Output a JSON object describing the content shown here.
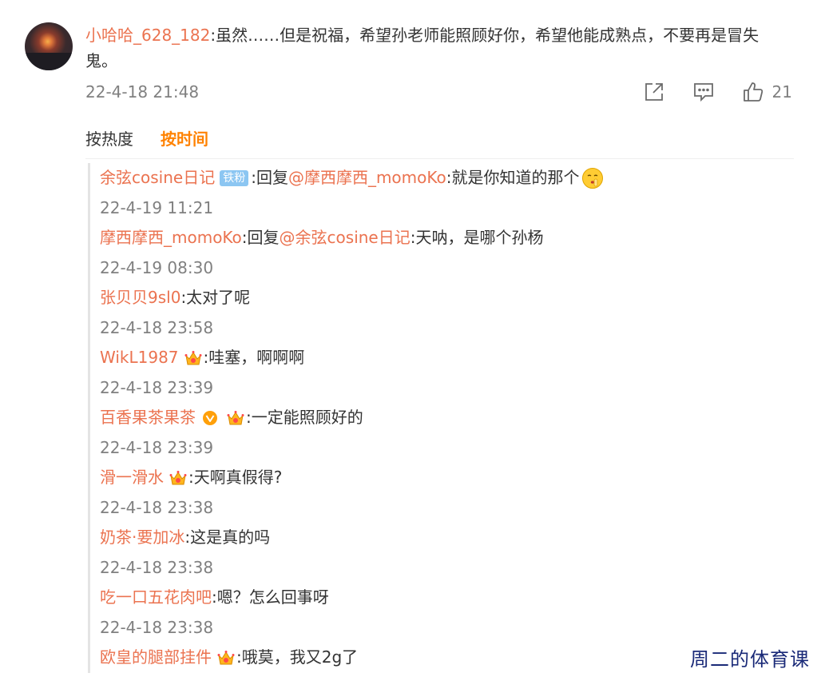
{
  "main_comment": {
    "username": "小哈哈_628_182",
    "text": ":虽然……但是祝福，希望孙老师能照顾好你，希望他能成熟点，不要再是冒失鬼。",
    "timestamp": "22-4-18 21:48",
    "like_count": "21",
    "icons": [
      "share-icon",
      "comment-icon",
      "like-icon"
    ]
  },
  "sort": {
    "hot": "按热度",
    "time": "按时间",
    "active": "time"
  },
  "replies": [
    {
      "user": "余弦cosine日记",
      "fan_badge": "铁粉",
      "reply_prefix": ":回复",
      "mention": "@摩西摩西_momoKo",
      "text": ":就是你知道的那个",
      "emoji": "shush-emoji",
      "time": "22-4-19 11:21"
    },
    {
      "user": "摩西摩西_momoKo",
      "reply_prefix": ":回复",
      "mention": "@余弦cosine日记",
      "text": ":天呐，是哪个孙杨",
      "time": "22-4-19 08:30"
    },
    {
      "user": "张贝贝9sl0",
      "text": ":太对了呢",
      "time": "22-4-18 23:58"
    },
    {
      "user": "WikL1987",
      "crown": true,
      "text": ":哇塞，啊啊啊",
      "time": "22-4-18 23:39"
    },
    {
      "user": "百香果茶果茶",
      "verified": true,
      "crown": true,
      "text": ":一定能照顾好的",
      "time": "22-4-18 23:39"
    },
    {
      "user": "滑一滑水",
      "crown": true,
      "text": ":天啊真假得?",
      "time": "22-4-18 23:38"
    },
    {
      "user": "奶茶·要加冰",
      "text": ":这是真的吗",
      "time": "22-4-18 23:38"
    },
    {
      "user": "吃一口五花肉吧",
      "text": ":嗯？怎么回事呀",
      "time": "22-4-18 23:38"
    },
    {
      "user": "欧皇的腿部挂件",
      "crown": true,
      "text": ":哦莫，我又2g了"
    }
  ],
  "watermark": "周二的体育课",
  "colors": {
    "username": "#eb7350",
    "active_sort": "#ff8200",
    "timestamp": "#808080",
    "fan_badge": "#8cc6f2",
    "verified": "#ffa00a",
    "text": "#333333"
  }
}
